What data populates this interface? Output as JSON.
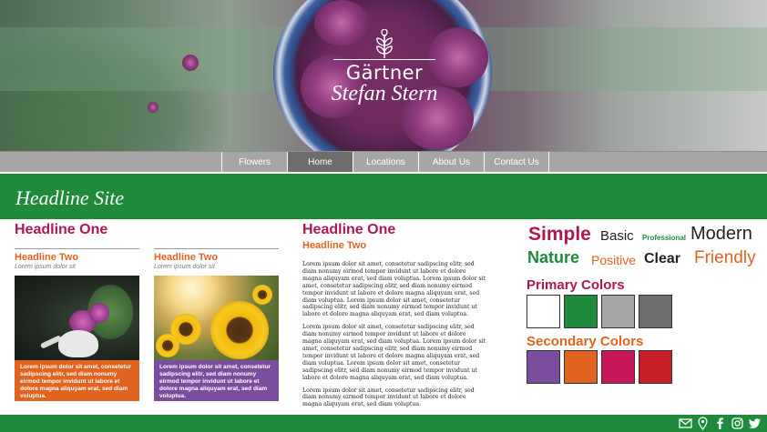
{
  "brand": {
    "line1": "Gärtner",
    "line2": "Stefan Stern"
  },
  "nav": {
    "items": [
      {
        "label": "Flowers"
      },
      {
        "label": "Home"
      },
      {
        "label": "Locations"
      },
      {
        "label": "About Us"
      },
      {
        "label": "Contact Us"
      }
    ],
    "active": "Home"
  },
  "site_headline": "Headline Site",
  "left": {
    "headline": "Headline One",
    "cards": [
      {
        "title": "Headline Two",
        "subtitle": "Lorem ipsum dolor sit",
        "body": "Lorem ipsum dolor sit amet, consetetur sadipscing elitr, sed diam nonumy eirmod tempor invidunt ut labore et dolore magna aliquyam erat, sed diam voluptua.",
        "color": "#e0631f"
      },
      {
        "title": "Headline Two",
        "subtitle": "Lorem ipsum dolor sit",
        "body": "Lorem ipsum dolor sit amet, consetetur sadipscing elitr, sed diam nonumy eirmod tempor invidunt ut labore et dolore magna aliquyam erat, sed diam voluptua.",
        "color": "#7b4d9e"
      }
    ]
  },
  "middle": {
    "headline": "Headline One",
    "subheadline": "Headline Two",
    "paragraphs": [
      "Lorem ipsum dolor sit amet, consetetur sadipscing elitr, sed diam nonumy eirmod tempor invidunt ut labore et dolore magna aliquyam erat, sed diam voluptua. Lorem ipsum dolor sit amet, consetetur sadipscing elitr, sed diam nonumy eirmod tempor invidunt ut labore et dolore magna aliquyam erat, sed diam voluptua. Lorem ipsum dolor sit amet, consetetur sadipscing elitr, sed diam nonumy eirmod tempor invidunt ut labore et dolore magna aliquyam erat, sed diam voluptua.",
      "Lorem ipsum dolor sit amet, consetetur sadipscing elitr, sed diam nonumy eirmod tempor invidunt ut labore et dolore magna aliquyam erat, sed diam voluptua. Lorem ipsum dolor sit amet, consetetur sadipscing elitr, sed diam nonumy eirmod tempor invidunt ut labore et dolore magna aliquyam erat, sed diam voluptua. Lorem ipsum dolor sit amet, consetetur sadipscing elitr, sed diam nonumy eirmod tempor invidunt ut labore et dolore magna aliquyam erat, sed diam voluptua.",
      "Lorem ipsum dolor sit amet, consetetur sadipscing elitr, sed diam nonumy eirmod tempor invidunt ut labore et dolore magna aliquyam erat, sed diam voluptua."
    ]
  },
  "keywords": [
    {
      "text": "Simple",
      "color": "#b0174e"
    },
    {
      "text": "Basic",
      "color": "#222222"
    },
    {
      "text": "Professional",
      "color": "#1f8a3c"
    },
    {
      "text": "Modern",
      "color": "#222222"
    },
    {
      "text": "Nature",
      "color": "#1f8a3c"
    },
    {
      "text": "Positive",
      "color": "#e0631f"
    },
    {
      "text": "Clear",
      "color": "#222222"
    },
    {
      "text": "Friendly",
      "color": "#e0631f"
    }
  ],
  "primary_colors": {
    "title": "Primary Colors",
    "swatches": [
      "#ffffff",
      "#1f8a3c",
      "#a6a6a6",
      "#6d6d6d"
    ]
  },
  "secondary_colors": {
    "title": "Secondary Colors",
    "swatches": [
      "#7b4d9e",
      "#e0631f",
      "#c8175a",
      "#c62026"
    ]
  },
  "theme": {
    "green": "#1f8a3c",
    "crimson": "#b0174e",
    "orange": "#e0631f",
    "nav_grey": "#a6a6a6",
    "nav_active": "#6d6d6d"
  },
  "footer": {
    "icons": [
      "mail-icon",
      "location-pin-icon",
      "facebook-icon",
      "instagram-icon",
      "twitter-icon"
    ]
  }
}
